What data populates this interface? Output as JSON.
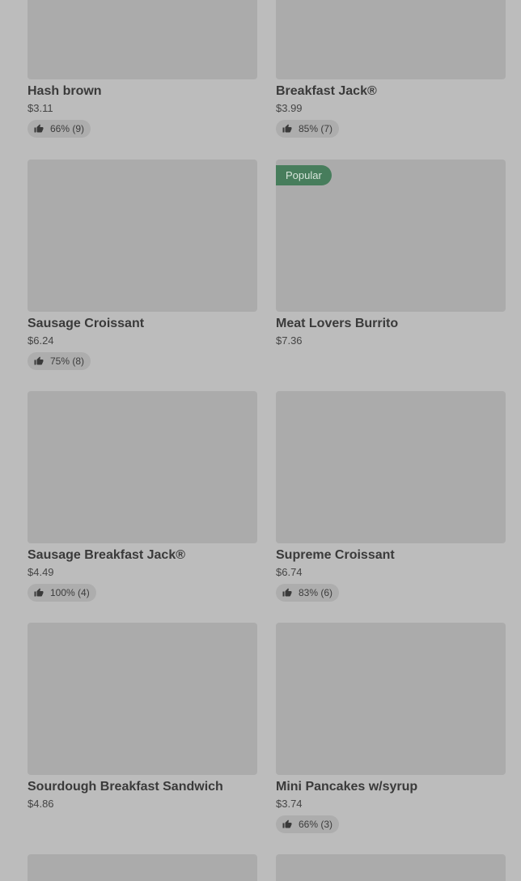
{
  "items": [
    {
      "name": "Hash brown",
      "price": "$3.11",
      "rating": "66% (9)"
    },
    {
      "name": "Breakfast Jack®",
      "price": "$3.99",
      "rating": "85% (7)"
    },
    {
      "name": "Sausage Croissant",
      "price": "$6.24",
      "rating": "75% (8)"
    },
    {
      "badge": "Popular",
      "name": "Meat Lovers Burrito",
      "price": "$7.36"
    },
    {
      "name": "Sausage Breakfast Jack®",
      "price": "$4.49",
      "rating": "100% (4)"
    },
    {
      "name": "Supreme Croissant",
      "price": "$6.74",
      "rating": "83% (6)"
    },
    {
      "name": "Sourdough Breakfast Sandwich",
      "price": "$4.86"
    },
    {
      "name": "Mini Pancakes w/syrup",
      "price": "$3.74",
      "rating": "66% (3)"
    }
  ],
  "icons": {
    "rating": "thumbs-up-icon"
  },
  "colors": {
    "badge": "#477d5c",
    "overlay": "#bcbcbc"
  }
}
